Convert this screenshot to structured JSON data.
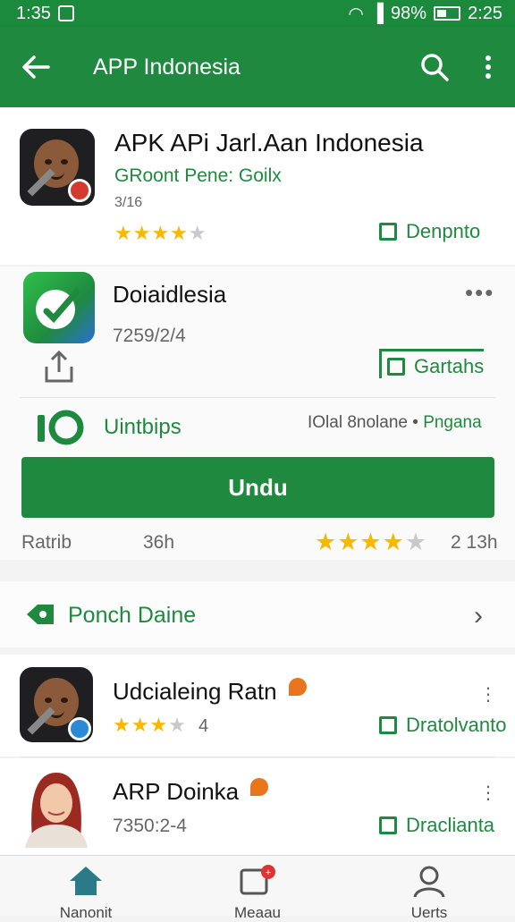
{
  "status_bar": {
    "time_left": "1:35",
    "battery_pct": "98%",
    "time_right": "2:25"
  },
  "app_bar": {
    "title": "APP Indonesia",
    "back_icon": "arrow-left-icon",
    "search_icon": "search-icon",
    "more_icon": "more-vertical-icon"
  },
  "top_app": {
    "title": "APK APi Jarl.Aan Indonesia",
    "developer": "GRoont Pene: Goilx",
    "size": "3/16",
    "rating": 4,
    "action_label": "Denpnto"
  },
  "featured_app": {
    "title": "Doiaidlesia",
    "version": "7259/2/4",
    "action_label": "Gartahs",
    "meta_left": "Uintbips",
    "meta_right_gray": "IOlal 8nolane •",
    "meta_right_green": "Pngana",
    "install_label": "Undu",
    "stats_left": "Ratrib",
    "stats_mid": "36h",
    "stats_rating": 4.5,
    "stats_right": "2 13h"
  },
  "section": {
    "title": "Ponch Daine"
  },
  "list_items": [
    {
      "title": "Udcialeing Ratn",
      "rating": 3,
      "count": "4",
      "action_label": "Dratolvanto"
    },
    {
      "title": "ARP Doinka",
      "version": "7350:2-4",
      "action_label": "Draclianta"
    }
  ],
  "nav": [
    {
      "label": "Nanonit",
      "icon": "home-icon"
    },
    {
      "label": "Meaau",
      "icon": "notifications-icon"
    },
    {
      "label": "Uerts",
      "icon": "user-icon"
    }
  ],
  "colors": {
    "primary": "#1f8a3f",
    "star": "#f6b800"
  }
}
